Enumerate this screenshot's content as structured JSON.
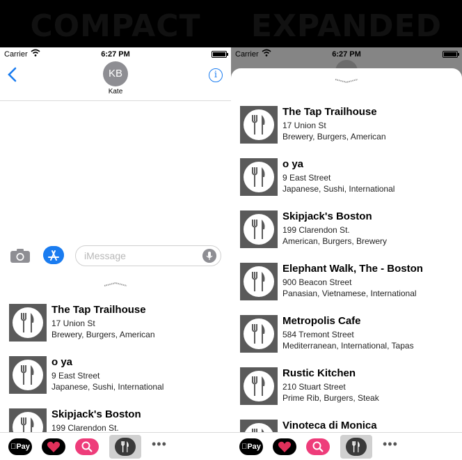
{
  "labels": {
    "compact": "COMPACT",
    "expanded": "EXPANDED"
  },
  "status_bar": {
    "carrier": "Carrier",
    "time": "6:27 PM"
  },
  "conversation": {
    "avatar_initials": "KB",
    "contact_name": "Kate",
    "info_symbol": "i"
  },
  "composer": {
    "placeholder": "iMessage"
  },
  "app_drawer": {
    "apple_pay_label": "Pay",
    "more": "•••"
  },
  "restaurants": [
    {
      "name": "The Tap Trailhouse",
      "address": "17 Union St",
      "tags": "Brewery, Burgers, American"
    },
    {
      "name": "o ya",
      "address": "9 East Street",
      "tags": "Japanese, Sushi, International"
    },
    {
      "name": "Skipjack's Boston",
      "address": "199 Clarendon St.",
      "tags": "American, Burgers, Brewery"
    },
    {
      "name": "Elephant Walk, The - Boston",
      "address": "900 Beacon Street",
      "tags": "Panasian, Vietnamese, International"
    },
    {
      "name": "Metropolis Cafe",
      "address": "584 Tremont Street",
      "tags": "Mediterranean, International, Tapas"
    },
    {
      "name": "Rustic Kitchen",
      "address": "210 Stuart Street",
      "tags": "Prime Rib, Burgers, Steak"
    },
    {
      "name": "Vinoteca di Monica",
      "address": "",
      "tags": ""
    }
  ],
  "colors": {
    "accent": "#1a7cf0",
    "heart_app": "#e0305a",
    "search_app": "#ee3c7a",
    "restaurant_thumb": "#5a5a5a"
  }
}
